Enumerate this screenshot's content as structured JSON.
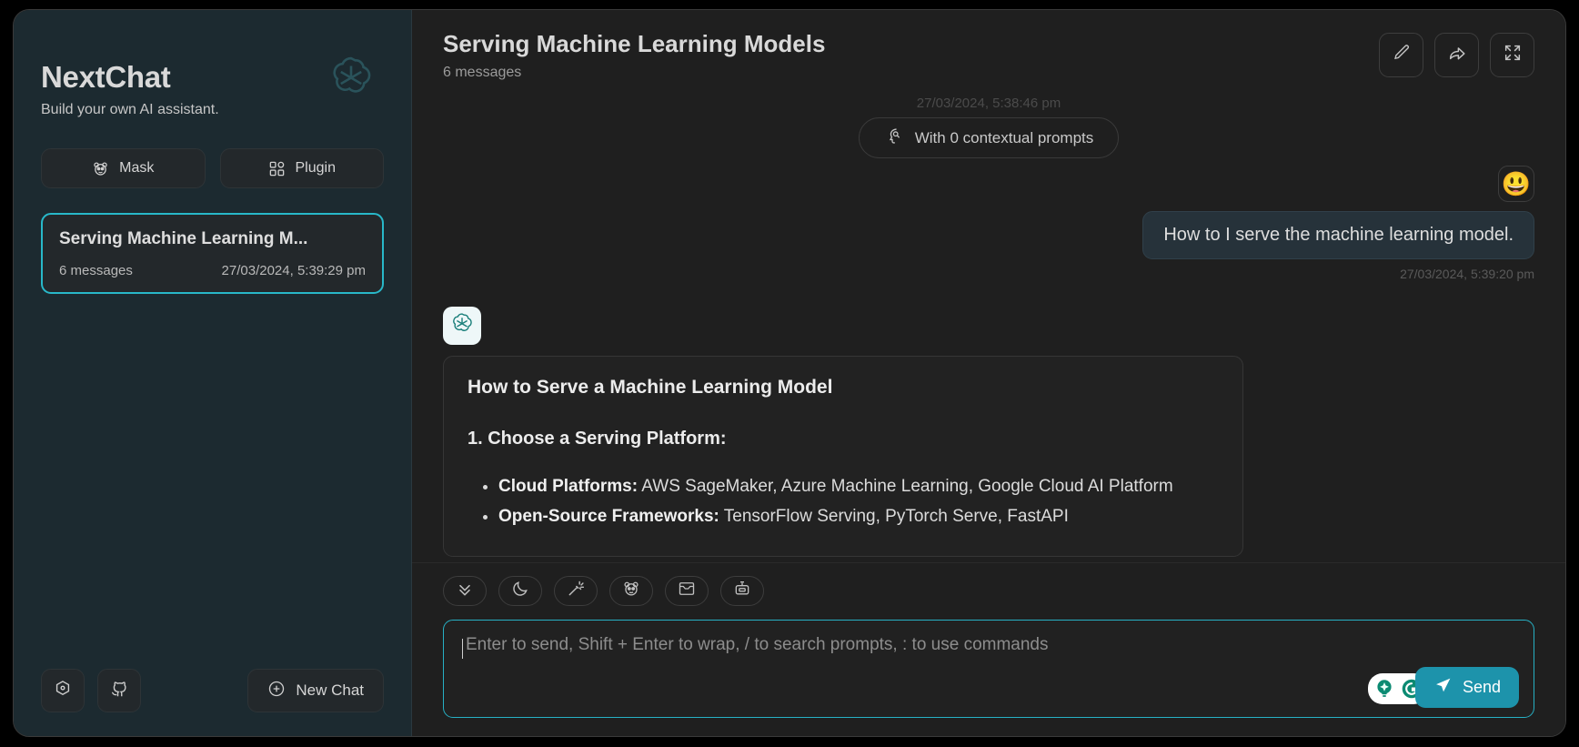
{
  "sidebar": {
    "brand_title": "NextChat",
    "brand_subtitle": "Build your own AI assistant.",
    "brand_logo_icon": "openai-logo-icon",
    "actions": [
      {
        "label": "Mask",
        "icon": "panda-mask-icon"
      },
      {
        "label": "Plugin",
        "icon": "grid-plugin-icon"
      }
    ],
    "chat_items": [
      {
        "title": "Serving Machine Learning M...",
        "message_count": "6 messages",
        "timestamp": "27/03/2024, 5:39:29 pm"
      }
    ],
    "footer": {
      "settings_icon": "settings-gear-icon",
      "github_icon": "github-icon",
      "new_chat_label": "New Chat",
      "new_chat_icon": "plus-circle-icon"
    }
  },
  "header": {
    "title": "Serving Machine Learning Models",
    "subtitle": "6 messages",
    "actions": [
      {
        "name": "rename-chat",
        "icon": "pencil-icon"
      },
      {
        "name": "share-chat",
        "icon": "share-arrow-icon"
      },
      {
        "name": "fullscreen-chat",
        "icon": "expand-icon"
      }
    ]
  },
  "conversation": {
    "context_time": "27/03/2024, 5:38:46 pm",
    "context_pill_label": "With 0 contextual prompts",
    "context_pill_icon": "brain-prompt-icon",
    "user_message": {
      "avatar_emoji": "😃",
      "text": "How to I serve the machine learning model.",
      "timestamp": "27/03/2024, 5:39:20 pm"
    },
    "bot_message": {
      "avatar_icon": "openai-logo-icon",
      "heading": "How to Serve a Machine Learning Model",
      "section_title": "1. Choose a Serving Platform:",
      "bullets": [
        {
          "label": "Cloud Platforms:",
          "text": " AWS SageMaker, Azure Machine Learning, Google Cloud AI Platform"
        },
        {
          "label": "Open-Source Frameworks:",
          "text": " TensorFlow Serving, PyTorch Serve, FastAPI"
        }
      ]
    }
  },
  "composer": {
    "tools": [
      {
        "name": "scroll-to-bottom",
        "icon": "chevrons-down-icon"
      },
      {
        "name": "toggle-theme",
        "icon": "moon-icon"
      },
      {
        "name": "prompt-magic",
        "icon": "magic-wand-icon"
      },
      {
        "name": "masks",
        "icon": "panda-mask-icon"
      },
      {
        "name": "clear-context",
        "icon": "inbox-icon"
      },
      {
        "name": "model-select",
        "icon": "robot-icon"
      }
    ],
    "input_placeholder": "Enter to send, Shift + Enter to wrap, / to search prompts, : to use commands",
    "input_value": "",
    "extras": [
      {
        "name": "grammarly-assistant",
        "icon": "lightbulb-icon"
      },
      {
        "name": "grammarly",
        "icon": "grammarly-g-icon"
      }
    ],
    "send_label": "Send",
    "send_icon": "send-plane-icon"
  },
  "colors": {
    "accent": "#27b0c4",
    "send_button": "#1d93ab",
    "sidebar_bg": "#1c2a30",
    "main_bg": "#1f1f1f"
  }
}
